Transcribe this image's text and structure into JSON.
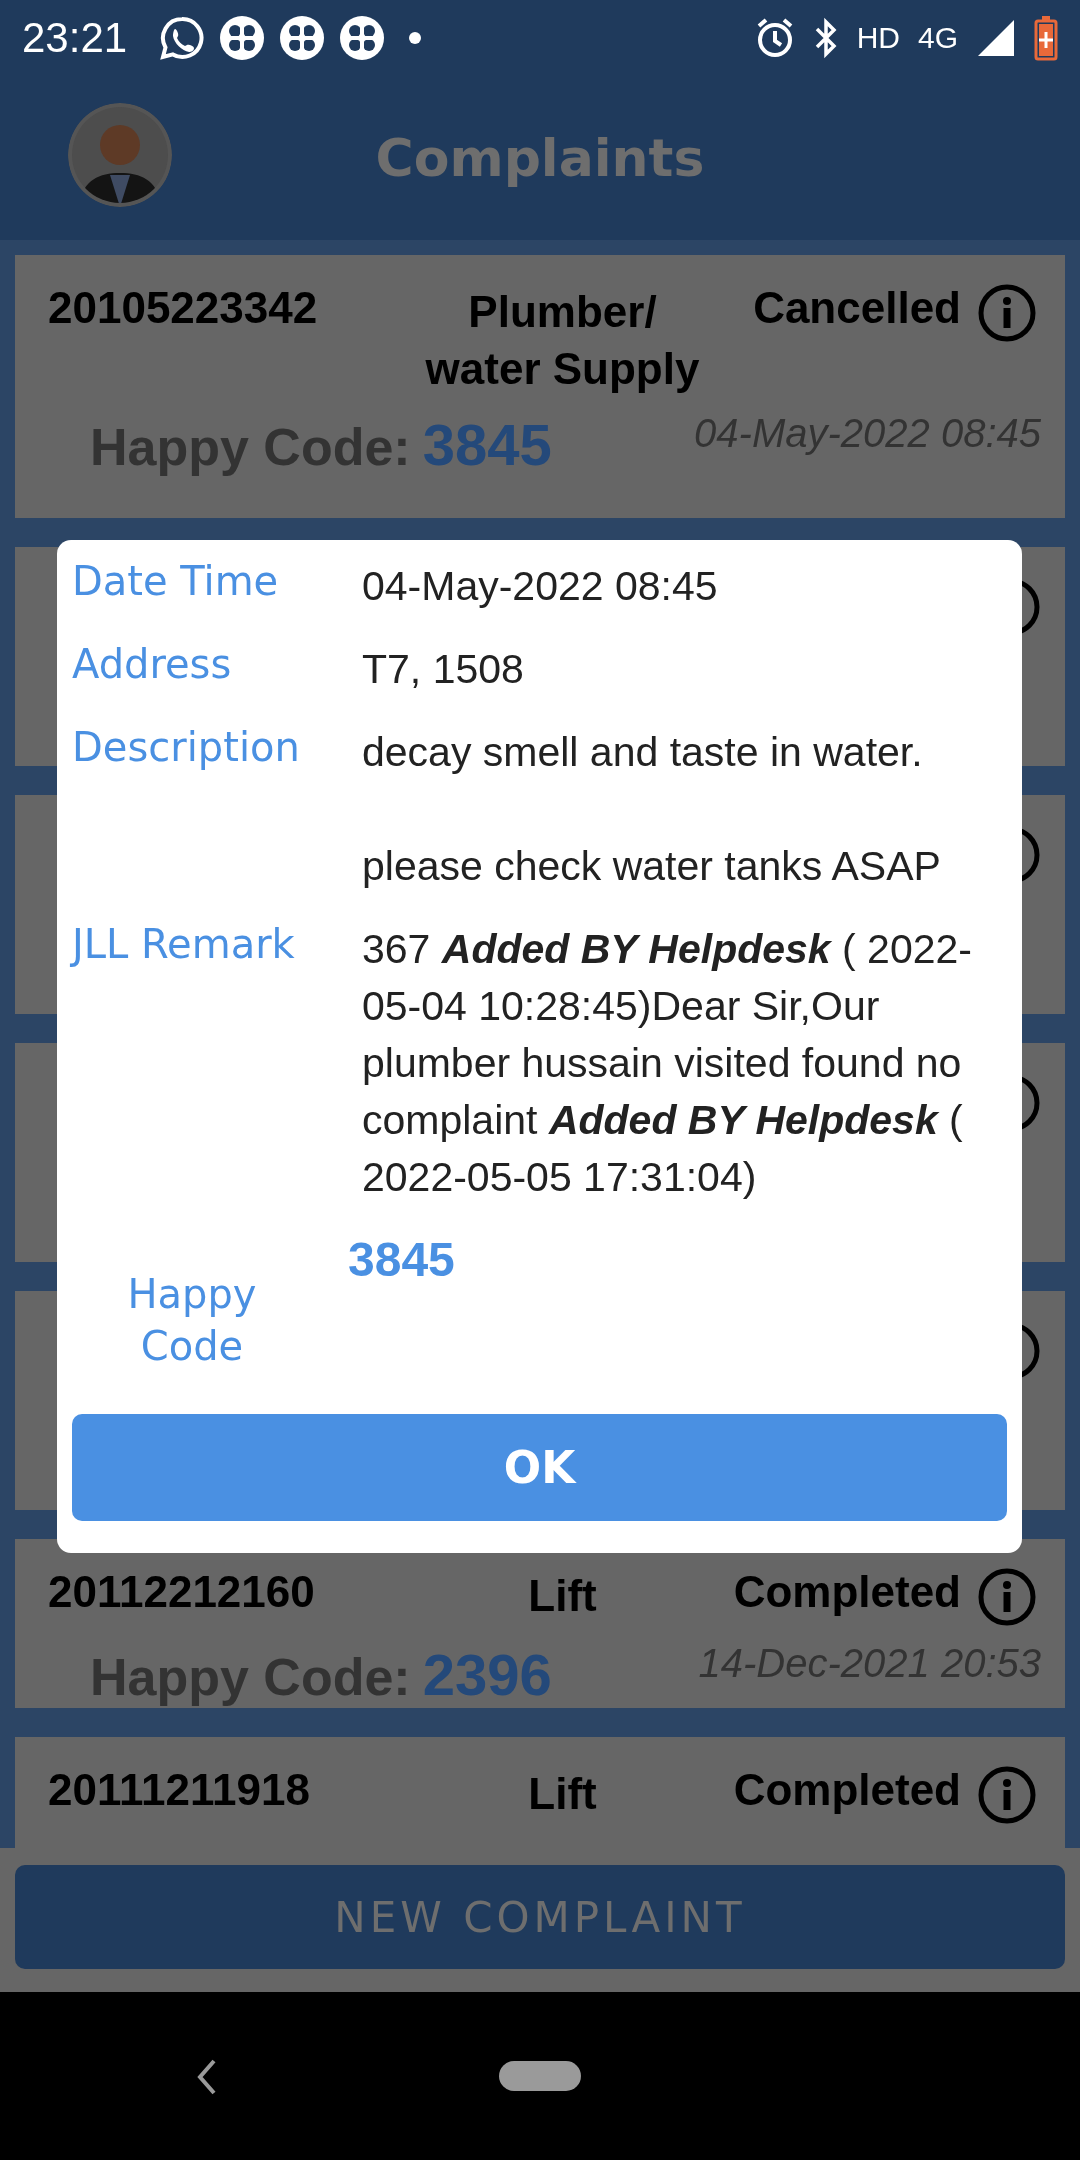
{
  "status_bar": {
    "time": "23:21",
    "network_labels": [
      "HD",
      "4G"
    ]
  },
  "header": {
    "title": "Complaints"
  },
  "complaints": [
    {
      "kind": "full",
      "number": "20105223342",
      "category": "Plumber/ water Supply",
      "status": "Cancelled",
      "happy_code_label": "Happy Code:",
      "happy_code": "3845",
      "date": "04-May-2022 08:45"
    },
    {
      "kind": "covered"
    },
    {
      "kind": "covered"
    },
    {
      "kind": "covered"
    },
    {
      "kind": "covered"
    },
    {
      "kind": "full",
      "number": "20112212160",
      "category": "Lift",
      "status": "Completed",
      "happy_code_label": "Happy Code:",
      "happy_code": "2396",
      "date": "14-Dec-2021 20:53"
    },
    {
      "kind": "full",
      "number": "20111211918",
      "category": "Lift",
      "status": "Completed"
    }
  ],
  "new_complaint_button": "NEW COMPLAINT",
  "dialog": {
    "rows": [
      {
        "label": "Date Time",
        "value": "04-May-2022 08:45",
        "kind": "text"
      },
      {
        "label": "Address",
        "value": "T7, 1508",
        "kind": "text"
      },
      {
        "label": "Description",
        "value": "decay smell and taste in water.\n\nplease check water tanks ASAP",
        "kind": "text"
      },
      {
        "label": "JLL Remark",
        "value": "367 **Added BY Helpdesk** ( 2022-05-04 10:28:45)Dear Sir,Our plumber hussain visited found no complaint **Added BY Helpdesk** ( 2022-05-05 17:31:04)",
        "kind": "text"
      },
      {
        "label": "Happy Code",
        "value": "3845",
        "kind": "code"
      }
    ],
    "ok_button": "OK"
  }
}
